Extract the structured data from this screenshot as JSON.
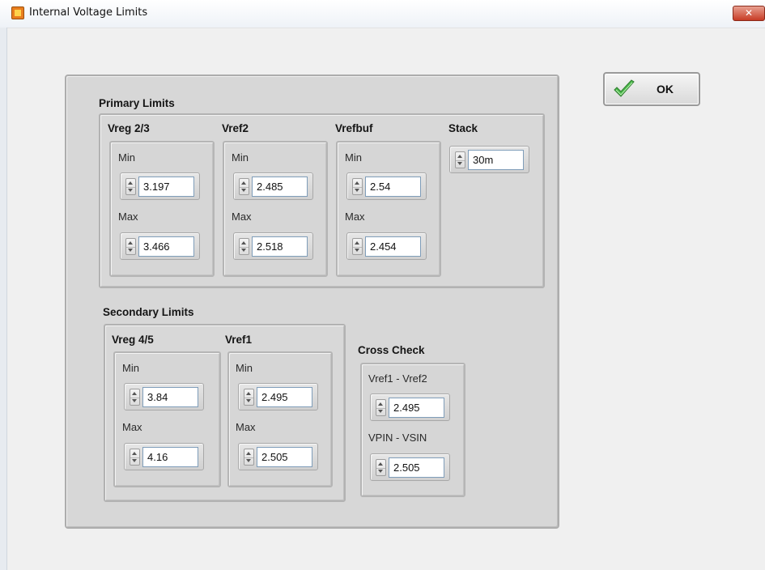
{
  "window": {
    "title": "Internal Voltage Limits",
    "close_label": "✕"
  },
  "ok_button": {
    "label": "OK",
    "icon": "checkmark-icon",
    "icon_color": "#3aa63a"
  },
  "primary": {
    "label": "Primary Limits",
    "vreg23": {
      "title": "Vreg 2/3",
      "min_label": "Min",
      "min": "3.197",
      "max_label": "Max",
      "max": "3.466"
    },
    "vref2": {
      "title": "Vref2",
      "min_label": "Min",
      "min": "2.485",
      "max_label": "Max",
      "max": "2.518"
    },
    "vrefbuf": {
      "title": "Vrefbuf",
      "min_label": "Min",
      "min": "2.54",
      "max_label": "Max",
      "max": "2.454"
    },
    "stack": {
      "title": "Stack",
      "value": "30m"
    }
  },
  "secondary": {
    "label": "Secondary Limits",
    "vreg45": {
      "title": "Vreg 4/5",
      "min_label": "Min",
      "min": "3.84",
      "max_label": "Max",
      "max": "4.16"
    },
    "vref1": {
      "title": "Vref1",
      "min_label": "Min",
      "min": "2.495",
      "max_label": "Max",
      "max": "2.505"
    }
  },
  "cross_check": {
    "label": "Cross Check",
    "vref1_vref2": {
      "label": "Vref1 - Vref2",
      "value": "2.495"
    },
    "vpin_vsin": {
      "label": "VPIN - VSIN",
      "value": "2.505"
    }
  }
}
